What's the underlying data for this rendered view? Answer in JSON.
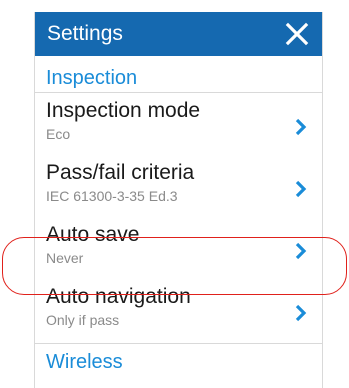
{
  "header": {
    "title": "Settings",
    "close_icon": "close-icon"
  },
  "sections": {
    "inspection": "Inspection",
    "wireless": "Wireless"
  },
  "items": [
    {
      "label": "Inspection mode",
      "value": "Eco"
    },
    {
      "label": "Pass/fail criteria",
      "value": "IEC 61300-3-35 Ed.3"
    },
    {
      "label": "Auto save",
      "value": "Never"
    },
    {
      "label": "Auto navigation",
      "value": "Only if pass"
    }
  ],
  "colors": {
    "header_bg": "#1569b0",
    "accent": "#1a8cd8",
    "highlight": "#e0211b"
  }
}
